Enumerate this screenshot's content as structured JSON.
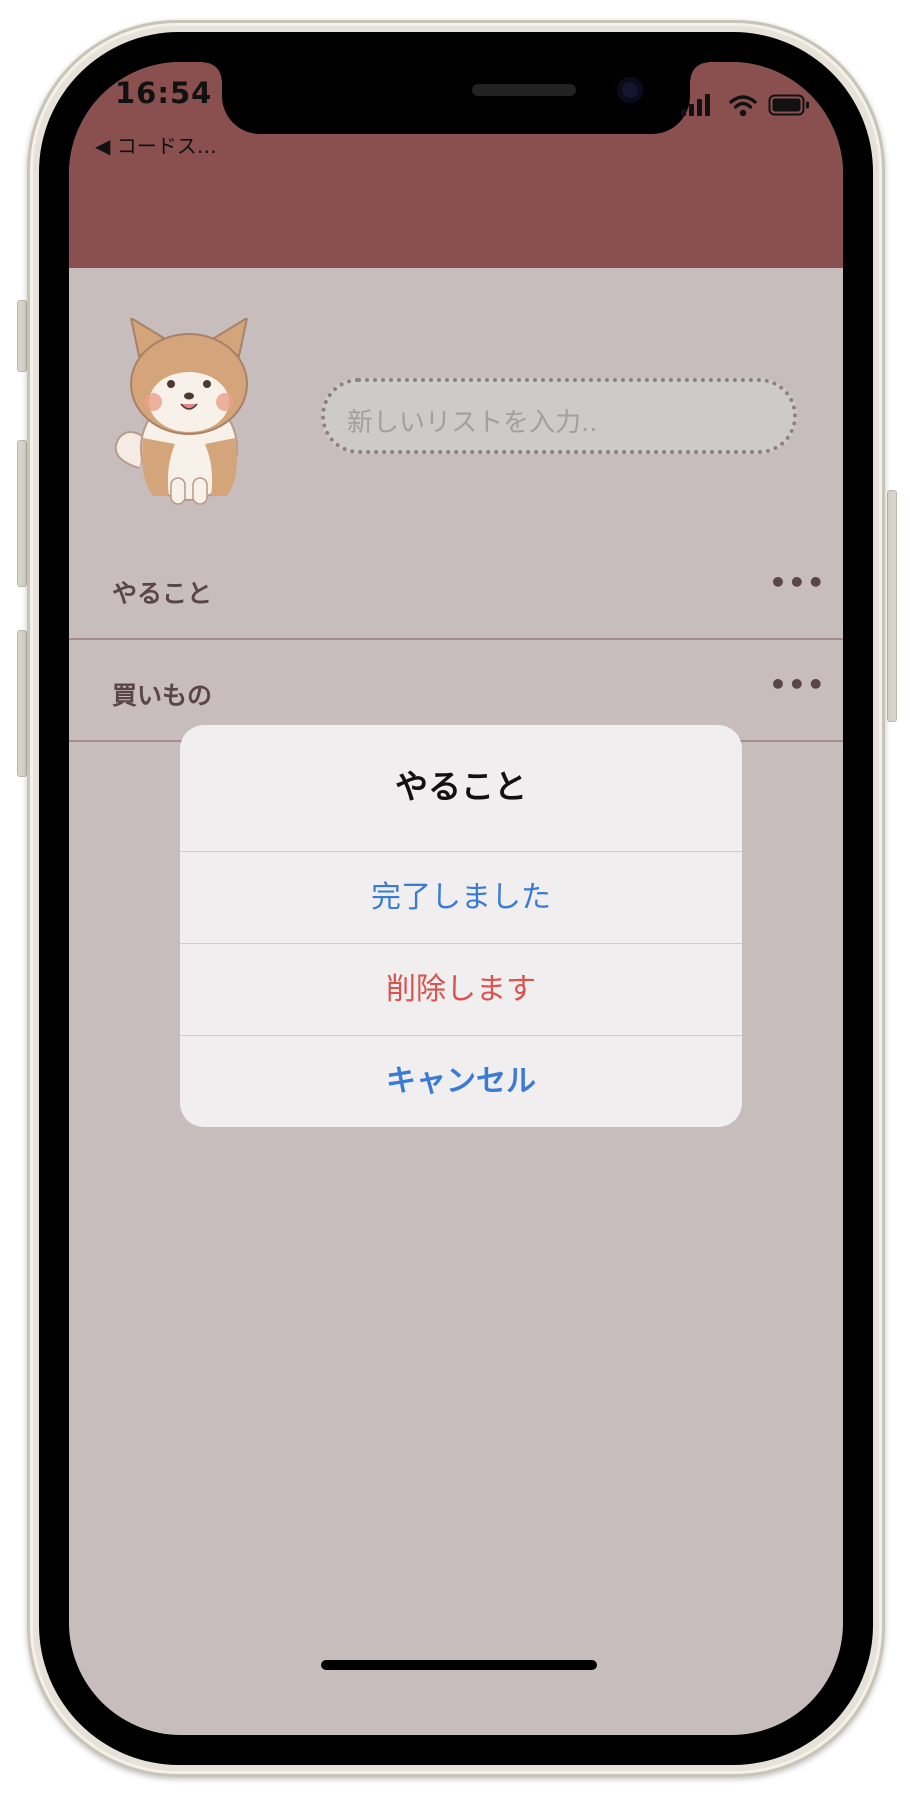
{
  "status_bar": {
    "time": "16:54",
    "back_label": "◀ コードス…"
  },
  "input": {
    "placeholder": "新しいリストを入力.."
  },
  "lists": [
    {
      "label": "やること",
      "more": "•••"
    },
    {
      "label": "買いもの",
      "more": "•••"
    }
  ],
  "action_sheet": {
    "title": "やること",
    "complete_label": "完了しました",
    "delete_label": "削除します",
    "cancel_label": "キャンセル"
  },
  "colors": {
    "nav_bar": "#8a5050",
    "screen_background": "#c8bdbd",
    "action_blue": "#3a7bd5",
    "destructive_red": "#d9534f"
  },
  "icons": [
    "signal-icon",
    "wifi-icon",
    "battery-icon",
    "more-icon",
    "shiba-dog-illustration"
  ]
}
